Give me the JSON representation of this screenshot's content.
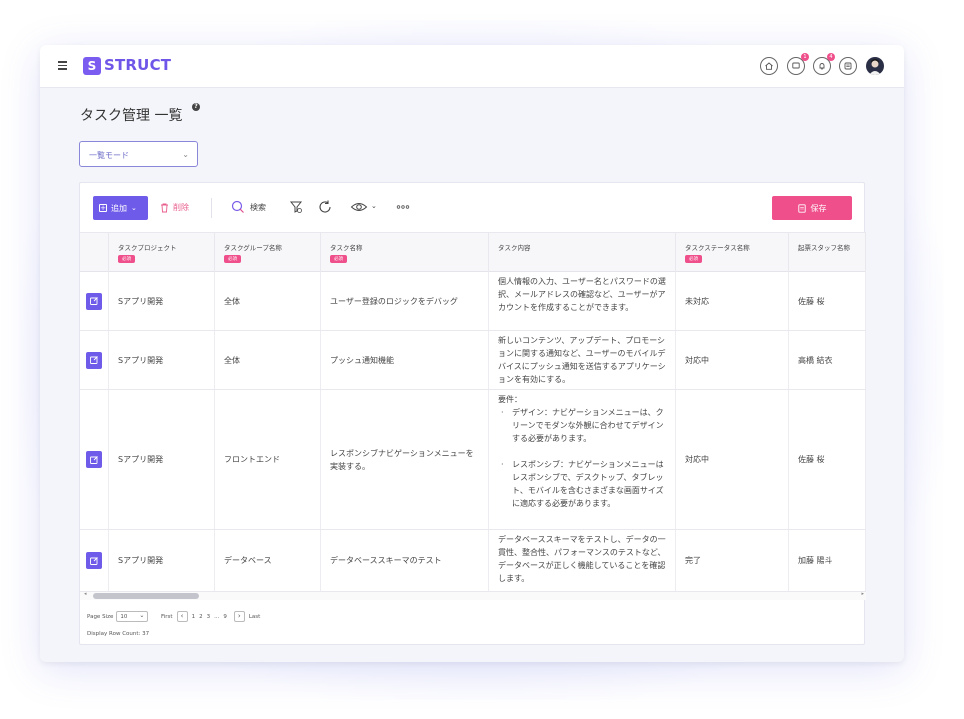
{
  "app": {
    "logo_letter": "S",
    "logo_text": "STRUCT",
    "accent": "#6f5be9",
    "danger": "#ef4f8a"
  },
  "header": {
    "icons": [
      {
        "name": "home-icon",
        "badge": ""
      },
      {
        "name": "chat-icon",
        "badge": "1"
      },
      {
        "name": "bell-icon",
        "badge": "4"
      },
      {
        "name": "notes-icon",
        "badge": ""
      }
    ]
  },
  "page": {
    "title": "タスク管理 一覧",
    "help": "?"
  },
  "mode_select": {
    "value": "一覧モード"
  },
  "toolbar": {
    "add_label": "追加",
    "delete_label": "削除",
    "search_label": "検索",
    "save_label": "保存"
  },
  "table": {
    "required_label": "必須",
    "columns": [
      {
        "label": "タスクプロジェクト",
        "required": true
      },
      {
        "label": "タスクグループ名称",
        "required": true
      },
      {
        "label": "タスク名称",
        "required": true
      },
      {
        "label": "タスク内容",
        "required": false
      },
      {
        "label": "タスクステータス名称",
        "required": true
      },
      {
        "label": "起票スタッフ名称",
        "required": false
      }
    ],
    "rows": [
      {
        "project": "Sアプリ開発",
        "group": "全体",
        "name": "ユーザー登録のロジックをデバッグ",
        "content": "個人情報の入力、ユーザー名とパスワードの選択、メールアドレスの確認など、ユーザーがアカウントを作成することができます。",
        "status": "未対応",
        "staff": "佐藤 桜"
      },
      {
        "project": "Sアプリ開発",
        "group": "全体",
        "name": "プッシュ通知機能",
        "content": "新しいコンテンツ、アップデート、プロモーションに関する通知など、ユーザーのモバイルデバイスにプッシュ通知を送信するアプリケーションを有効にする。",
        "status": "対応中",
        "staff": "高橋 結衣"
      },
      {
        "project": "Sアプリ開発",
        "group": "フロントエンド",
        "name": "レスポンシブナビゲーションメニューを実装する。",
        "content_intro": "要件：",
        "content_bullets": [
          "デザイン：ナビゲーションメニューは、クリーンでモダンな外観に合わせてデザインする必要があります。",
          "レスポンシブ：ナビゲーションメニューはレスポンシブで、デスクトップ、タブレット、モバイルを含むさまざまな画面サイズに適応する必要があります。"
        ],
        "status": "対応中",
        "staff": "佐藤 桜"
      },
      {
        "project": "Sアプリ開発",
        "group": "データベース",
        "name": "データベーススキーマのテスト",
        "content": "データベーススキーマをテストし、データの一貫性、整合性、パフォーマンスのテストなど、データベースが正しく機能していることを確認します。",
        "status": "完了",
        "staff": "加藤 陽斗"
      }
    ]
  },
  "footer": {
    "page_size_label": "Page Size",
    "page_size_value": "10",
    "first_label": "First",
    "pages": [
      "1",
      "2",
      "3",
      "...",
      "9"
    ],
    "last_label": "Last",
    "row_count_text": "Display Row Count: 37"
  }
}
